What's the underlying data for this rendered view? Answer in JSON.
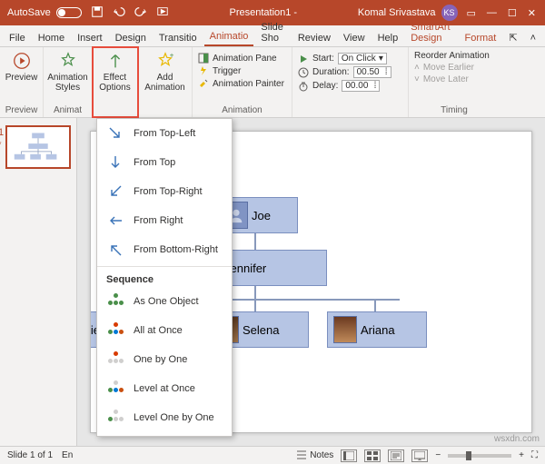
{
  "titlebar": {
    "autosave": "AutoSave",
    "doc_title": "Presentation1 -",
    "user": "Komal Srivastava",
    "user_initials": "KS"
  },
  "tabs": {
    "file": "File",
    "home": "Home",
    "insert": "Insert",
    "design": "Design",
    "transitions": "Transitio",
    "animations": "Animatio",
    "slideshow": "Slide Sho",
    "review": "Review",
    "view": "View",
    "help": "Help",
    "smartart": "SmartArt Design",
    "format": "Format"
  },
  "ribbon": {
    "preview": "Preview",
    "preview_group": "Preview",
    "anim_styles": "Animation\nStyles",
    "effect_options": "Effect\nOptions",
    "animat_group": "Animat",
    "add_anim": "Add\nAnimation",
    "anim_pane": "Animation Pane",
    "trigger": "Trigger",
    "anim_painter": "Animation Painter",
    "animation_group": "Animation",
    "start": "Start:",
    "start_val": "On Click",
    "duration": "Duration:",
    "duration_val": "00.50",
    "delay": "Delay:",
    "delay_val": "00.00",
    "reorder": "Reorder Animation",
    "move_earlier": "Move Earlier",
    "move_later": "Move Later",
    "timing_group": "Timing"
  },
  "dropdown": {
    "from_top_left": "From Top-Left",
    "from_top": "From Top",
    "from_top_right": "From Top-Right",
    "from_right": "From Right",
    "from_bottom_right": "From Bottom-Right",
    "sequence": "Sequence",
    "as_one_object": "As One Object",
    "all_at_once": "All at Once",
    "one_by_one": "One by One",
    "level_at_once": "Level at Once",
    "level_one_by_one": "Level One by One"
  },
  "nodes": {
    "joe": "Joe",
    "jennifer": "Jennifer",
    "lie": "lie",
    "selena": "Selena",
    "ariana": "Ariana"
  },
  "status": {
    "slide_count": "Slide 1 of 1",
    "lang": "En",
    "notes": "Notes"
  },
  "watermark": "wsxdn.com",
  "thumb_num": "1",
  "thumb_star": "*"
}
